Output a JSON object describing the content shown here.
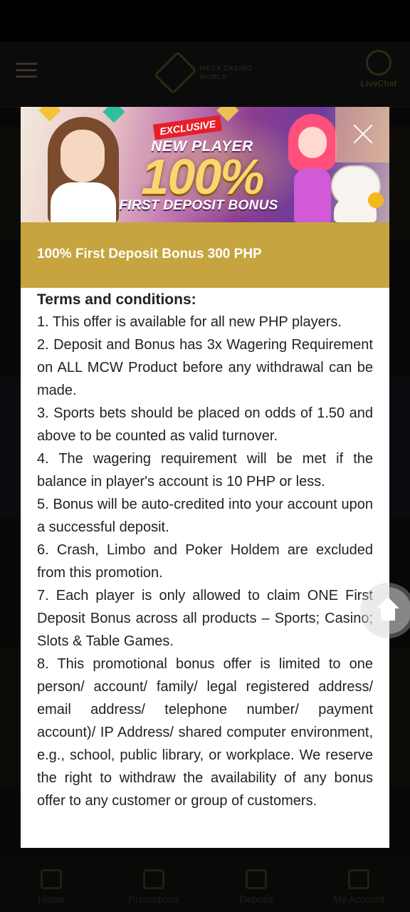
{
  "background_app": {
    "logo_text": "MEGA CASINO WORLD",
    "livechat_label": "LiveChat",
    "bottom_nav": [
      "Home",
      "Promotions",
      "Deposit",
      "My Account"
    ]
  },
  "modal": {
    "banner": {
      "exclusive": "EXCLUSIVE",
      "new_player": "NEW PLAYER",
      "percent": "100%",
      "first_deposit_bonus": "FIRST DEPOSIT BONUS"
    },
    "close_icon": "close-icon",
    "title": "100% First Deposit Bonus 300 PHP",
    "terms_heading": "Terms and conditions:",
    "terms": [
      "1. This offer is available for all new PHP players.",
      "2. Deposit and Bonus has 3x Wagering Requirement on ALL MCW Product before any withdrawal can be made.",
      "3. Sports bets should be placed on odds of 1.50 and above to be counted as valid turnover.",
      "4. The wagering requirement will be met if the balance in player's account is 10 PHP or less.",
      "5. Bonus will be auto-credited into your account upon a successful deposit.",
      "6. Crash, Limbo and Poker Holdem are excluded from this promotion.",
      "7. Each player is only allowed to claim ONE First Deposit Bonus across all products – Sports; Casino; Slots & Table Games.",
      "8. This promotional bonus offer is limited to one person/ account/ family/ legal registered address/ email address/ telephone number/ payment account)/ IP Address/ shared computer environment, e.g., school, public library, or workplace. We reserve the right to withdraw the availability of any bonus offer to any customer or group of customers."
    ]
  },
  "float_button": {
    "icon": "home-icon"
  },
  "colors": {
    "gold": "#c6a43f",
    "modal_bg": "#ffffff",
    "overlay": "#000000"
  }
}
